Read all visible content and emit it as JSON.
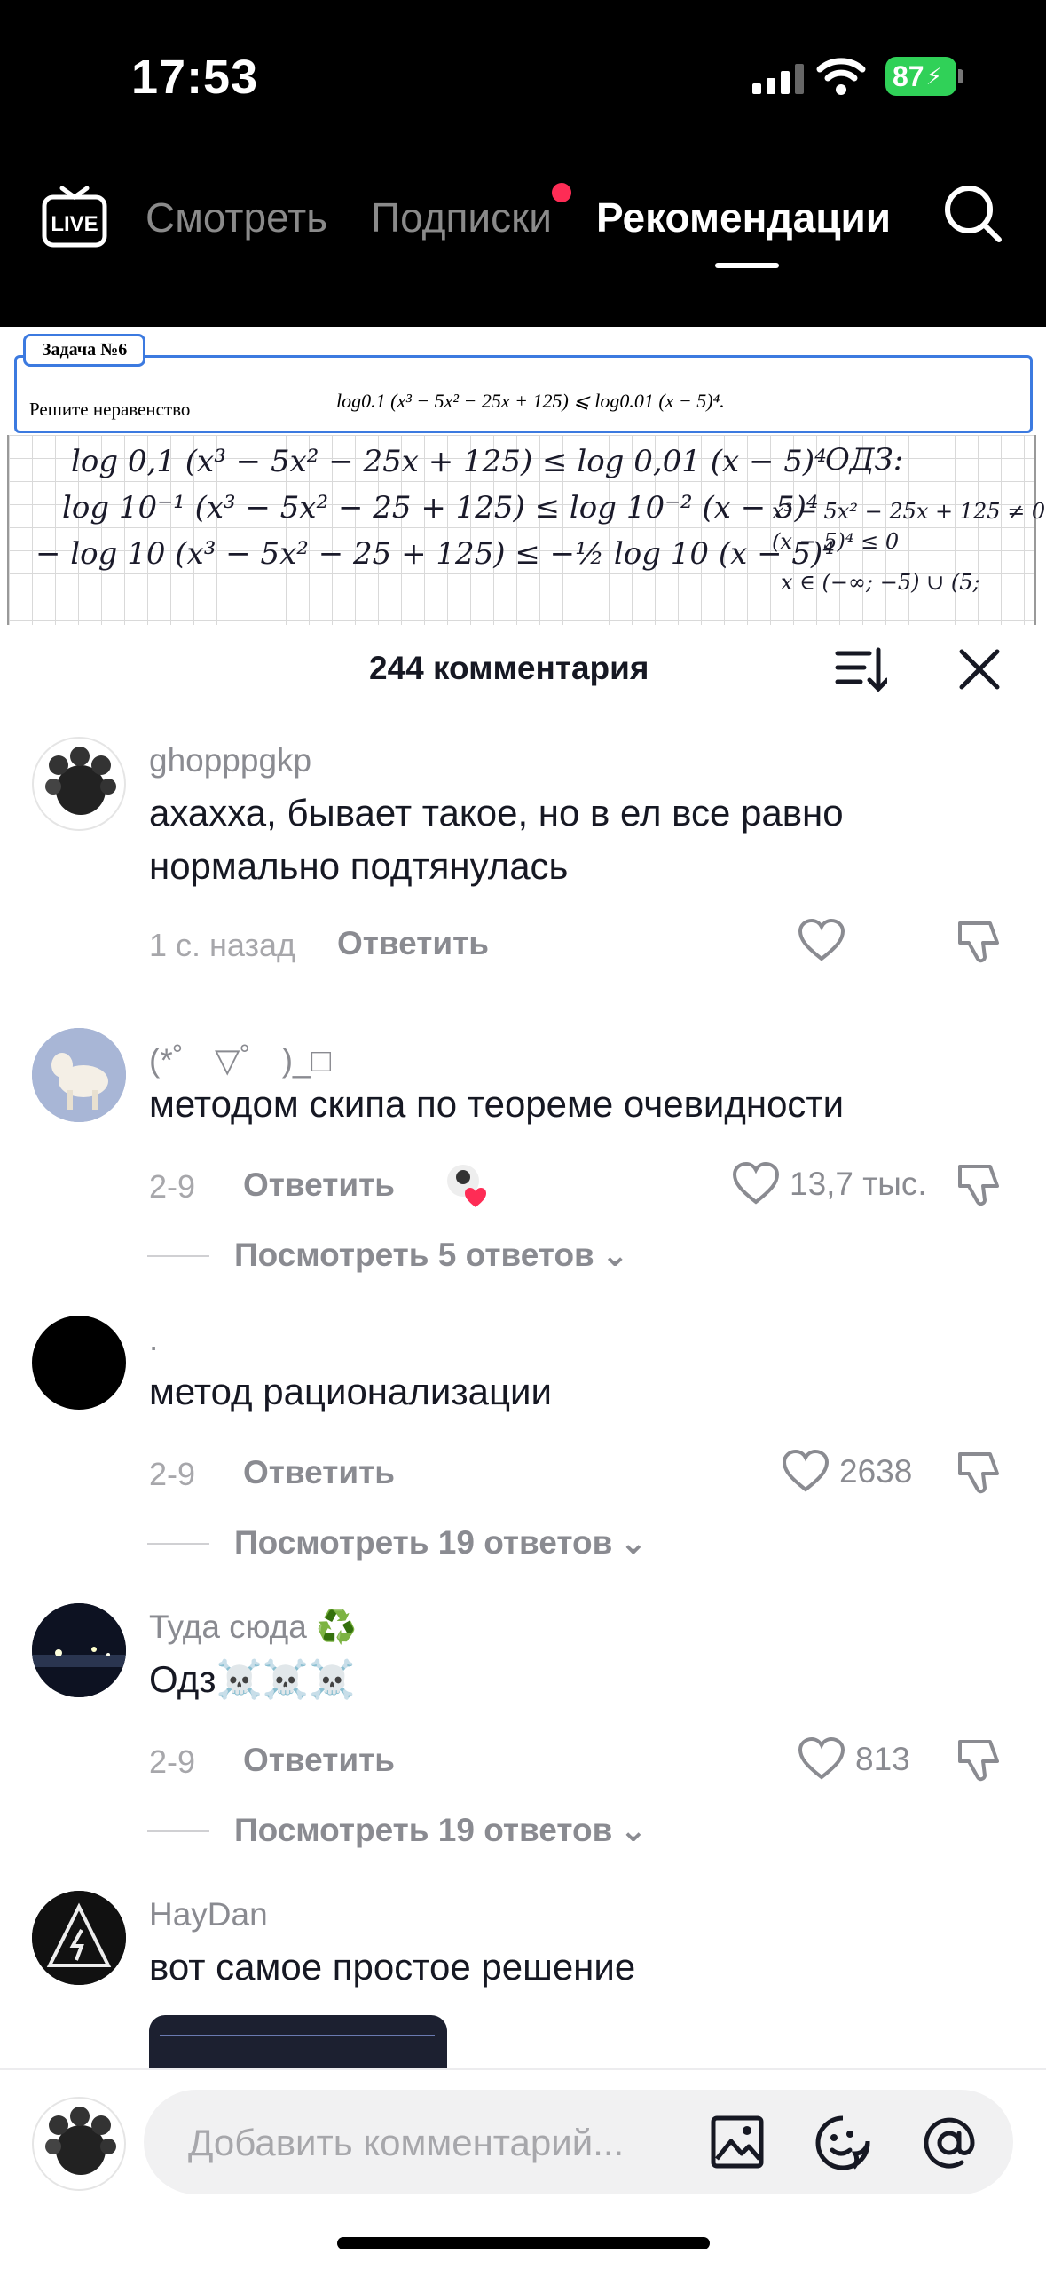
{
  "status_bar": {
    "time": "17:53",
    "battery": "87"
  },
  "top_nav": {
    "tabs": [
      {
        "label": "Смотреть"
      },
      {
        "label": "Подписки"
      },
      {
        "label": "Рекомендации"
      }
    ]
  },
  "video": {
    "task_tag": "Задача №6",
    "task_text": "Решите неравенство",
    "task_formula": "log0.1 (x³ − 5x² − 25x + 125) ⩽ log0.01 (x − 5)⁴.",
    "handwriting": [
      "log 0,1 (x³ − 5x² − 25x + 125) ≤ log 0,01 (x − 5)⁴",
      "log 10⁻¹ (x³ − 5x² − 25 + 125) ≤ log 10⁻² (x − 5)⁴",
      "− log 10 (x³ − 5x² − 25 + 125) ≤ −½ log 10 (x − 5)⁴",
      "ОДЗ:",
      "x³ − 5x² − 25x + 125 ≠ 0",
      "(x − 5)⁴ ≤ 0",
      "x ∈ (−∞; −5) ∪ (5;"
    ]
  },
  "comments_header": {
    "count_label": "244 комментария"
  },
  "comments": [
    {
      "username": "ghopppgkp",
      "text": "ахахха, бывает такое, но в ел все равно нормально подтянулась",
      "time": "1 с. назад",
      "reply": "Ответить",
      "likes": ""
    },
    {
      "username": "(*゜ ▽゜ )_□",
      "text": "методом скипа по теореме очевидности",
      "time": "2-9",
      "reply": "Ответить",
      "likes": "13,7 тыс.",
      "view_replies": "Посмотреть 5 ответов"
    },
    {
      "username": ".",
      "text": "метод рационализации",
      "time": "2-9",
      "reply": "Ответить",
      "likes": "2638",
      "view_replies": "Посмотреть 19 ответов"
    },
    {
      "username": "Туда сюда ♻️",
      "text": "Одз☠️☠️☠️",
      "time": "2-9",
      "reply": "Ответить",
      "likes": "813",
      "view_replies": "Посмотреть 19 ответов"
    },
    {
      "username": "HayDan",
      "text": "вот самое простое решение"
    }
  ],
  "input": {
    "placeholder": "Добавить комментарий..."
  },
  "colors": {
    "accent": "#fe2c55",
    "battery": "#30d158",
    "brand_blue": "#3c7ae0"
  }
}
